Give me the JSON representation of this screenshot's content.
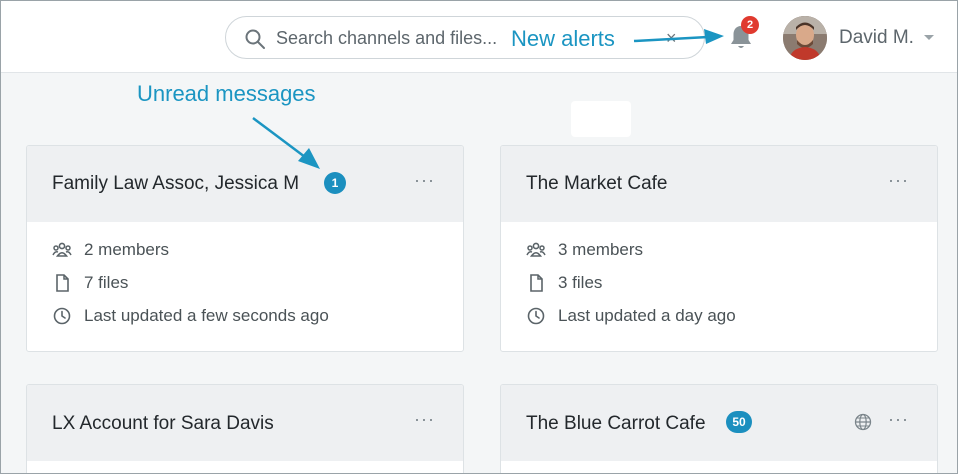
{
  "header": {
    "search_placeholder": "Search channels and files...",
    "clear_symbol": "×",
    "notification_count": "2",
    "user_name": "David M."
  },
  "annotations": {
    "new_alerts": "New alerts",
    "unread_messages": "Unread messages"
  },
  "cards": [
    {
      "title": "Family Law Assoc, Jessica M",
      "badge": "1",
      "more": "···",
      "members": "2 members",
      "files": "7 files",
      "updated": "Last updated a few seconds ago"
    },
    {
      "title": "The Market Cafe",
      "more": "···",
      "members": "3 members",
      "files": "3 files",
      "updated": "Last updated a day ago"
    },
    {
      "title": "LX Account for Sara Davis",
      "more": "···"
    },
    {
      "title": "The Blue Carrot Cafe",
      "badge": "50",
      "more": "···",
      "icon": "globe-icon"
    }
  ],
  "colors": {
    "accent": "#1b95c2",
    "badge": "#1b8fbf",
    "alert": "#e03a2f",
    "card_header": "#eef0f2",
    "background": "#f4f6f7"
  }
}
